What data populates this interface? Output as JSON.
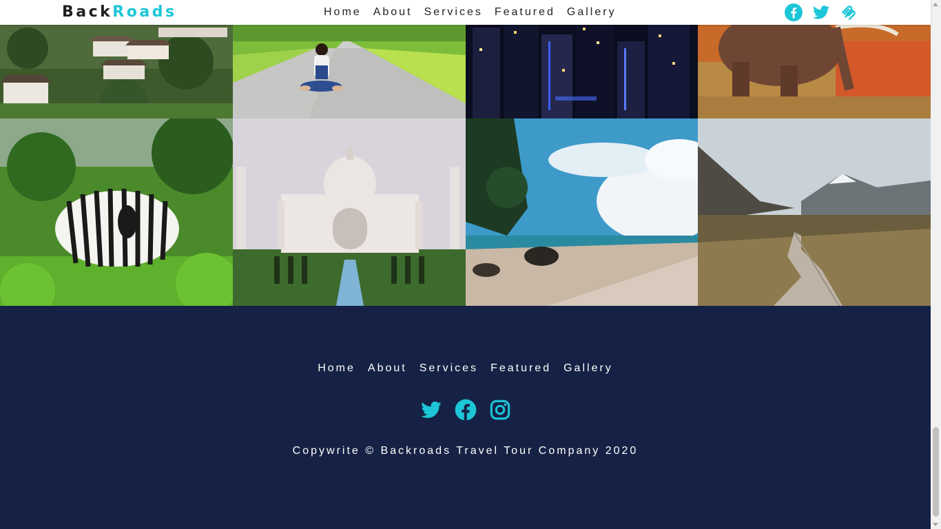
{
  "brand": {
    "part1": "Back",
    "part2": "Roads",
    "accent_color": "#1cc6d8"
  },
  "nav": {
    "links": [
      "Home",
      "About",
      "Services",
      "Featured",
      "Gallery"
    ],
    "icons": [
      "facebook-icon",
      "twitter-icon",
      "squarespace-icon"
    ]
  },
  "gallery": {
    "tiles": [
      "village-hillside-photo",
      "woman-on-road-photo",
      "city-night-photo",
      "elephant-photo",
      "zebras-photo",
      "taj-mahal-photo",
      "beach-photo",
      "mountain-boardwalk-photo"
    ]
  },
  "footer": {
    "links": [
      "Home",
      "About",
      "Services",
      "Featured",
      "Gallery"
    ],
    "icons": [
      "twitter-icon",
      "facebook-icon",
      "instagram-icon"
    ],
    "copyright": "Copywrite © Backroads Travel Tour Company 2020",
    "background": "#152245",
    "icon_color": "#1cc6d8"
  }
}
